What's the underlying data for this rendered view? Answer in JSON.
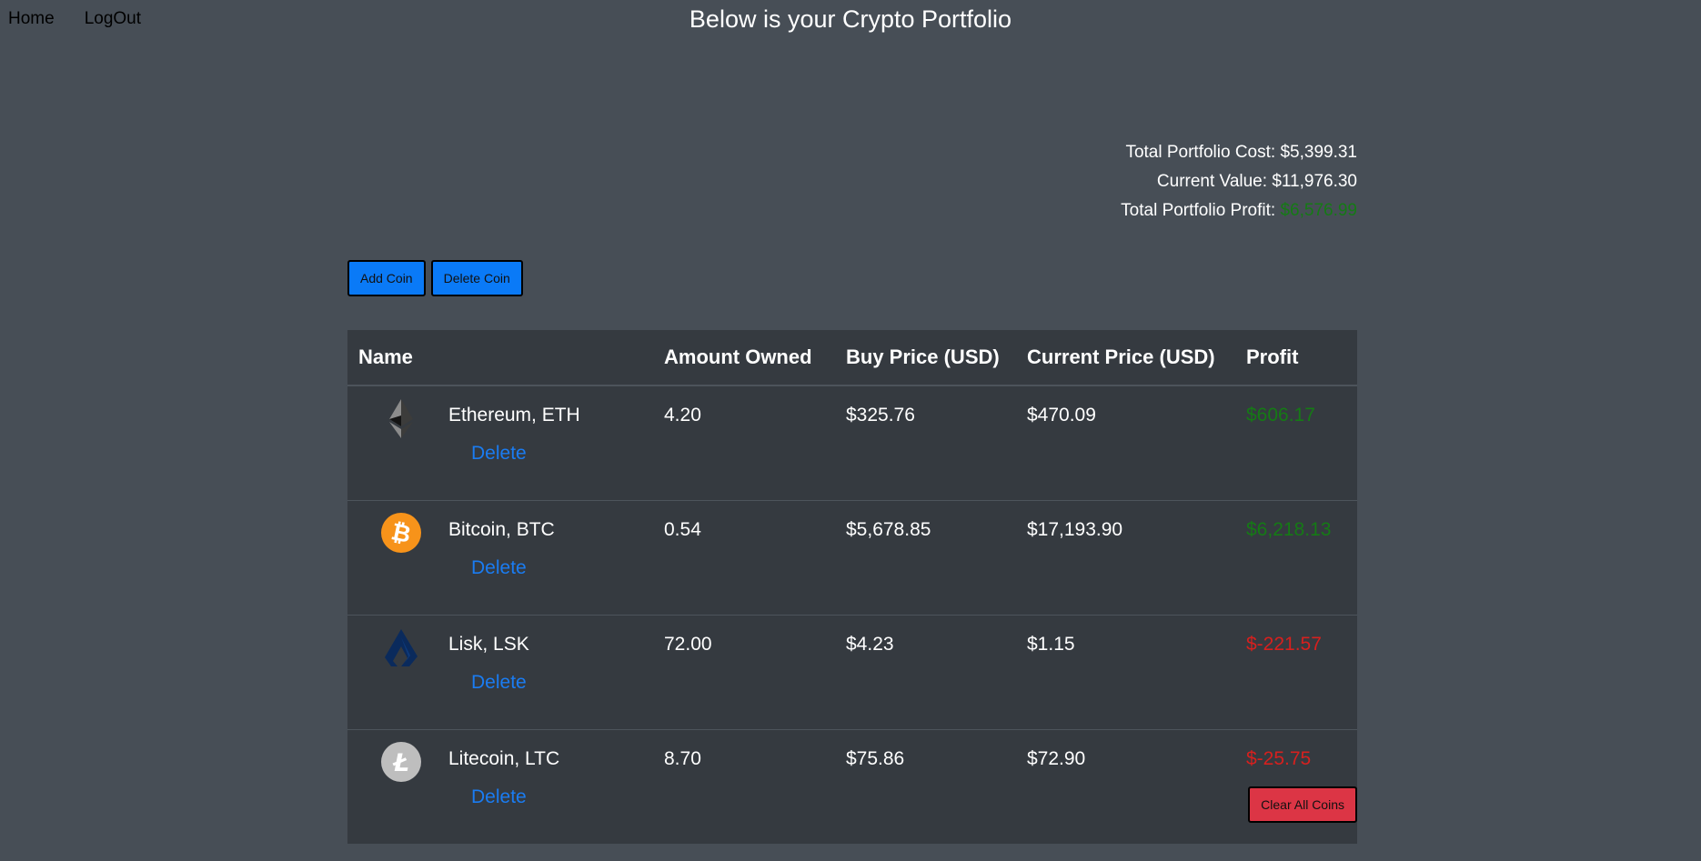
{
  "nav": {
    "home": "Home",
    "logout": "LogOut"
  },
  "page_title": "Below is your Crypto Portfolio",
  "summary": {
    "cost_label": "Total Portfolio Cost:",
    "cost_value": "$5,399.31",
    "current_label": "Current Value:",
    "current_value": "$11,976.30",
    "profit_label": "Total Portfolio Profit:",
    "profit_value": "$6,576.99"
  },
  "buttons": {
    "add_coin": "Add Coin",
    "delete_coin": "Delete Coin",
    "clear_all": "Clear All Coins"
  },
  "table": {
    "headers": [
      "Name",
      "Amount Owned",
      "Buy Price (USD)",
      "Current Price (USD)",
      "Profit"
    ],
    "delete_label": "Delete",
    "rows": [
      {
        "icon": "ethereum-icon",
        "name": "Ethereum, ETH",
        "amount": "4.20",
        "buy": "$325.76",
        "current": "$470.09",
        "profit": "$606.17",
        "profit_sign": "pos"
      },
      {
        "icon": "bitcoin-icon",
        "name": "Bitcoin, BTC",
        "amount": "0.54",
        "buy": "$5,678.85",
        "current": "$17,193.90",
        "profit": "$6,218.13",
        "profit_sign": "pos"
      },
      {
        "icon": "lisk-icon",
        "name": "Lisk, LSK",
        "amount": "72.00",
        "buy": "$4.23",
        "current": "$1.15",
        "profit": "$-221.57",
        "profit_sign": "neg"
      },
      {
        "icon": "litecoin-icon",
        "name": "Litecoin, LTC",
        "amount": "8.70",
        "buy": "$75.86",
        "current": "$72.90",
        "profit": "$-25.75",
        "profit_sign": "neg"
      }
    ]
  },
  "colors": {
    "background": "#474e56",
    "table_bg": "#353a40",
    "positive": "#157a15",
    "negative": "#d6201e",
    "link": "#1a7cf2",
    "primary_button": "#0a7af7",
    "danger_button": "#dc3545"
  }
}
